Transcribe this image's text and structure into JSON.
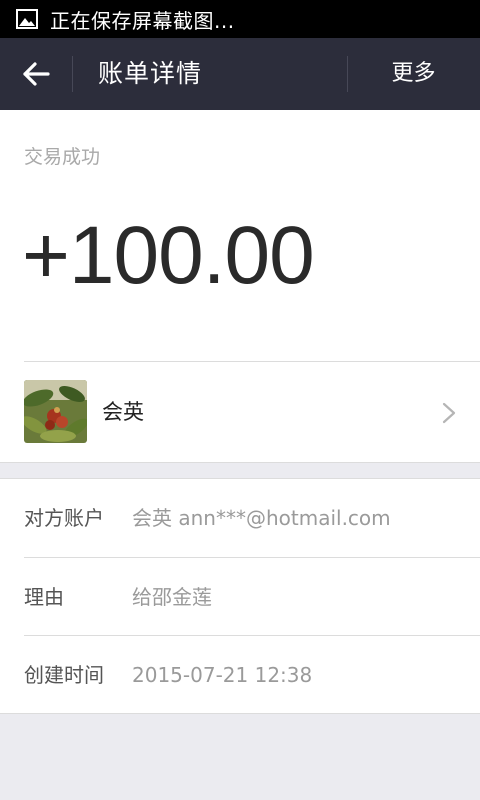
{
  "status_bar": {
    "notification_icon": "image-icon",
    "text": "正在保存屏幕截图..."
  },
  "header": {
    "back_icon": "arrow-left-icon",
    "title": "账单详情",
    "more_label": "更多",
    "background": "#2c2d3b"
  },
  "summary": {
    "status": "交易成功",
    "amount": "+100.00",
    "payer": {
      "avatar_icon": "avatar-photo",
      "name": "会英",
      "chevron_icon": "chevron-right-icon"
    }
  },
  "details": {
    "rows": [
      {
        "label": "对方账户",
        "value": "会英 ann***@hotmail.com"
      },
      {
        "label": "理由",
        "value": "给邵金莲"
      },
      {
        "label": "创建时间",
        "value": "2015-07-21 12:38"
      }
    ]
  },
  "colors": {
    "page_background": "#ebebf0",
    "muted_text": "#9a9a9a"
  }
}
